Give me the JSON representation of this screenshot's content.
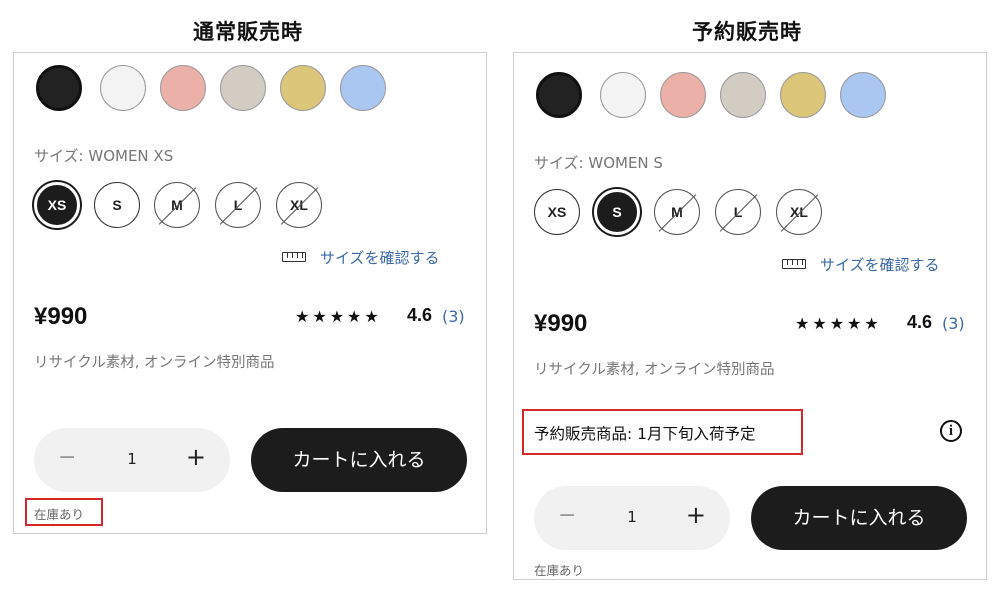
{
  "panels": [
    {
      "heading": "通常販売時",
      "swatches": [
        "#222222",
        "#f3f3f3",
        "#ebb0a7",
        "#d3ccc3",
        "#dcc67a",
        "#a9c7f0"
      ],
      "selected_swatch": 0,
      "size_label": "サイズ: WOMEN XS",
      "sizes": [
        {
          "label": "XS",
          "state": "selected"
        },
        {
          "label": "S",
          "state": "available"
        },
        {
          "label": "M",
          "state": "unavailable"
        },
        {
          "label": "L",
          "state": "unavailable"
        },
        {
          "label": "XL",
          "state": "unavailable"
        }
      ],
      "size_guide_link": "サイズを確認する",
      "price": "¥990",
      "stars": "★★★★★",
      "rating": "4.6",
      "review_count": "(3)",
      "description": "リサイクル素材, オンライン特別商品",
      "quantity": {
        "minus": "−",
        "value": "1",
        "plus": "+"
      },
      "cart_button": "カートに入れる",
      "stock_status": "在庫あり",
      "stock_highlighted": true
    },
    {
      "heading": "予約販売時",
      "swatches": [
        "#222222",
        "#f3f3f3",
        "#ebb0a7",
        "#d3ccc3",
        "#dcc67a",
        "#a9c7f0"
      ],
      "selected_swatch": 0,
      "size_label": "サイズ: WOMEN S",
      "sizes": [
        {
          "label": "XS",
          "state": "available"
        },
        {
          "label": "S",
          "state": "selected"
        },
        {
          "label": "M",
          "state": "unavailable"
        },
        {
          "label": "L",
          "state": "unavailable"
        },
        {
          "label": "XL",
          "state": "unavailable"
        }
      ],
      "size_guide_link": "サイズを確認する",
      "price": "¥990",
      "stars": "★★★★★",
      "rating": "4.6",
      "review_count": "(3)",
      "description": "リサイクル素材, オンライン特別商品",
      "preorder_notice": "予約販売商品: 1月下旬入荷予定",
      "info_icon": "i",
      "quantity": {
        "minus": "−",
        "value": "1",
        "plus": "+"
      },
      "cart_button": "カートに入れる",
      "stock_status": "在庫あり",
      "stock_highlighted": false
    }
  ],
  "colors": {
    "highlight": "#d6272b",
    "link": "#3d6aa6",
    "button": "#1c1c1c"
  }
}
